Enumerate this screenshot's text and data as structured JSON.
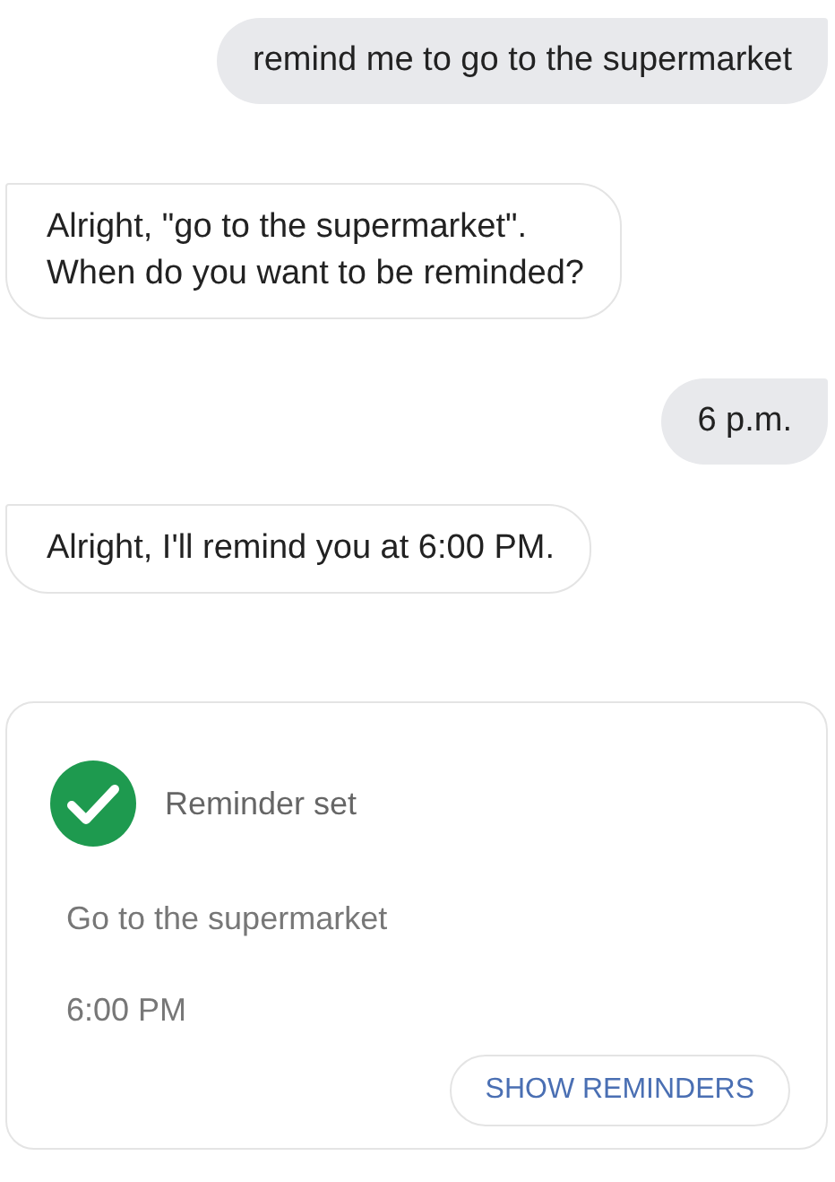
{
  "messages": [
    {
      "kind": "user",
      "text": "remind me to go to the supermarket"
    },
    {
      "kind": "assistant",
      "text": "Alright, \"go to the supermarket\".\nWhen do you want to be reminded?"
    },
    {
      "kind": "user",
      "text": "6 p.m."
    },
    {
      "kind": "assistant",
      "text": "Alright, I'll remind you at 6:00 PM."
    }
  ],
  "reminder_card": {
    "status": "Reminder set",
    "title": "Go to the supermarket",
    "time": "6:00 PM",
    "button": "SHOW REMINDERS"
  }
}
